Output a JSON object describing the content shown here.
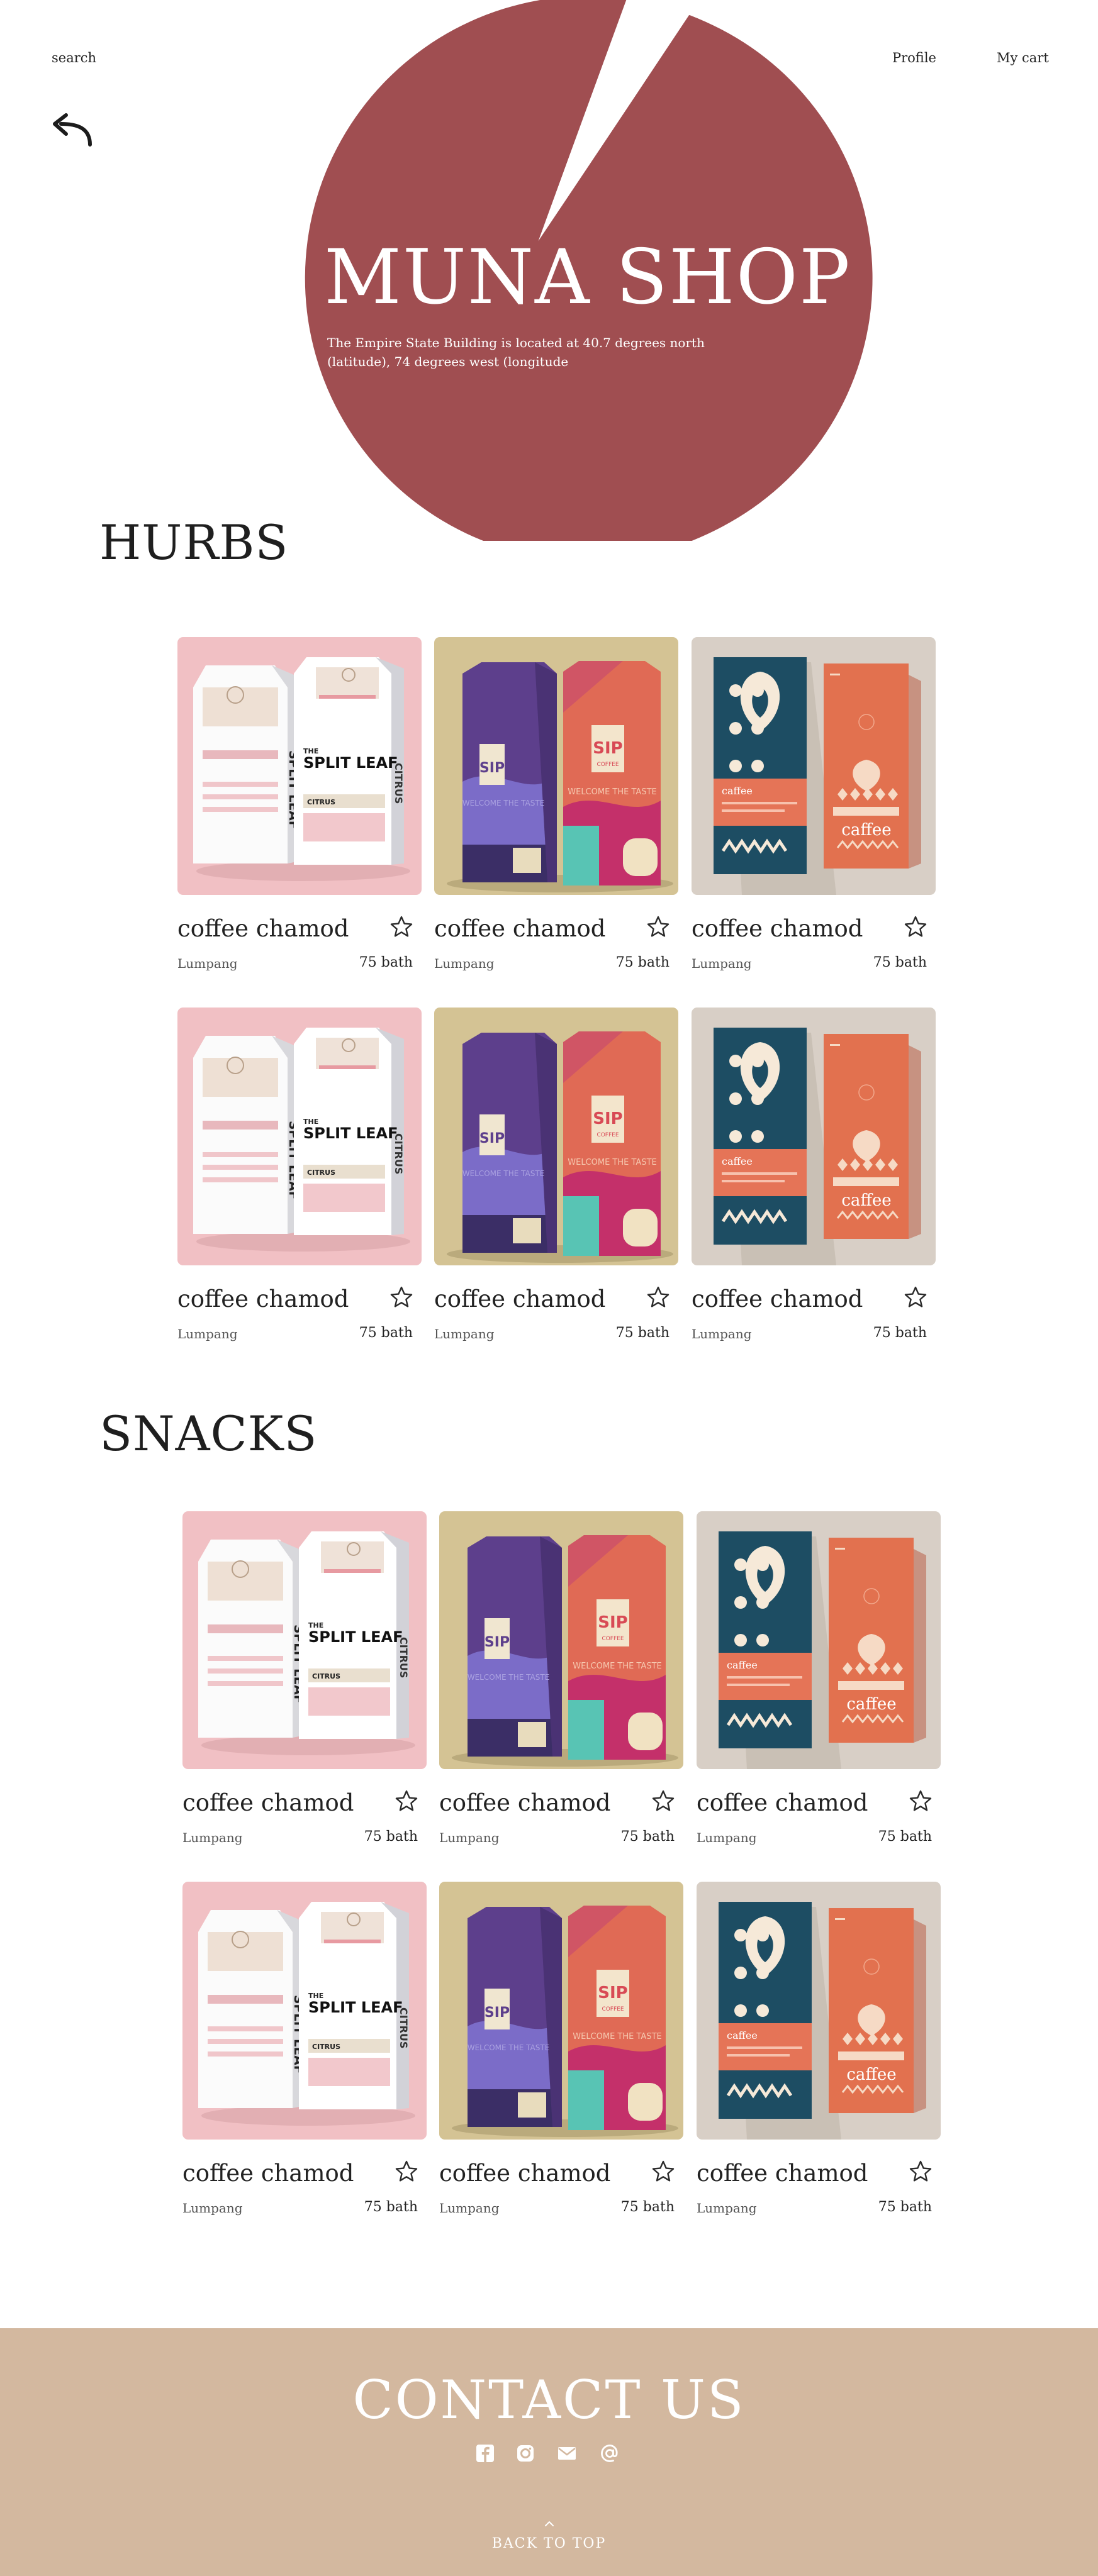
{
  "nav": {
    "search_label": "search",
    "profile_label": "Profile",
    "cart_label": "My cart",
    "back_icon": "back-arrow-icon"
  },
  "hero": {
    "title": "MUNA SHOP",
    "subtitle": "The Empire State Building is located at 40.7 degrees north (latitude), 74 degrees west (longitude",
    "accent_color": "#a04e51"
  },
  "sections": [
    {
      "title": "HURBS",
      "products": [
        {
          "name": "coffee chamod",
          "place": "Lumpang",
          "price": "75 bath",
          "image": "split-leaf"
        },
        {
          "name": "coffee chamod",
          "place": "Lumpang",
          "price": "75 bath",
          "image": "sip-coffee"
        },
        {
          "name": "coffee chamod",
          "place": "Lumpang",
          "price": "75 bath",
          "image": "caffee"
        },
        {
          "name": "coffee chamod",
          "place": "Lumpang",
          "price": "75 bath",
          "image": "split-leaf"
        },
        {
          "name": "coffee chamod",
          "place": "Lumpang",
          "price": "75 bath",
          "image": "sip-coffee"
        },
        {
          "name": "coffee chamod",
          "place": "Lumpang",
          "price": "75 bath",
          "image": "caffee"
        }
      ]
    },
    {
      "title": "SNACKS",
      "products": [
        {
          "name": "coffee chamod",
          "place": "Lumpang",
          "price": "75 bath",
          "image": "split-leaf"
        },
        {
          "name": "coffee chamod",
          "place": "Lumpang",
          "price": "75 bath",
          "image": "sip-coffee"
        },
        {
          "name": "coffee chamod",
          "place": "Lumpang",
          "price": "75 bath",
          "image": "caffee"
        },
        {
          "name": "coffee chamod",
          "place": "Lumpang",
          "price": "75 bath",
          "image": "split-leaf"
        },
        {
          "name": "coffee chamod",
          "place": "Lumpang",
          "price": "75 bath",
          "image": "sip-coffee"
        },
        {
          "name": "coffee chamod",
          "place": "Lumpang",
          "price": "75 bath",
          "image": "caffee"
        }
      ]
    }
  ],
  "product_art": {
    "split_leaf": {
      "brand_the": "THE",
      "brand": "SPLIT LEAF",
      "flavor": "CITRUS"
    },
    "sip": {
      "brand": "SIP",
      "sub": "COFFEE",
      "tagline": "WELCOME THE TASTE"
    },
    "caffee": {
      "brand": "caffee"
    }
  },
  "footer": {
    "title": "CONTACT US",
    "social_icons": [
      "facebook-icon",
      "instagram-icon",
      "mail-icon",
      "at-sign-icon"
    ],
    "back_to_top": "BACK  TO TOP",
    "background": "#d3b89f"
  }
}
